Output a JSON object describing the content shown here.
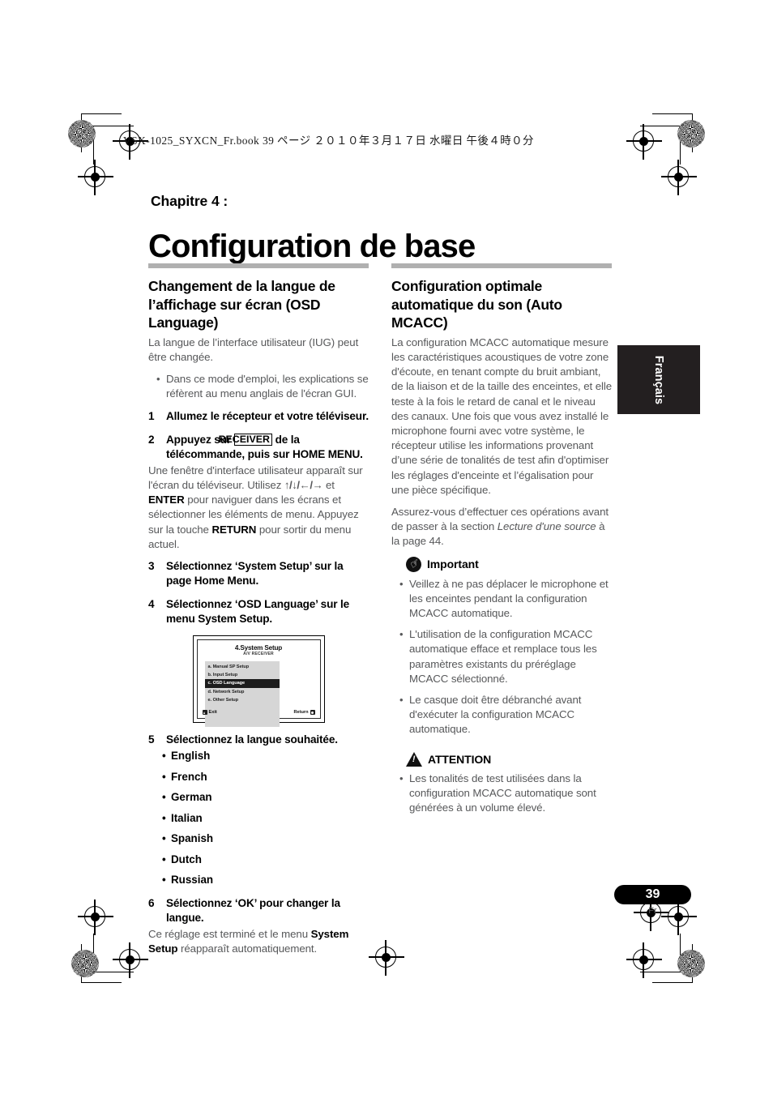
{
  "running_header": "VSX-1025_SYXCN_Fr.book   39 ページ   ２０１０年３月１７日   水曜日   午後４時０分",
  "chapter": {
    "label": "Chapitre 4 :",
    "title": "Configuration de base"
  },
  "side_tab": {
    "label": "Français"
  },
  "page_footer": {
    "number": "39",
    "language_code": "Fr"
  },
  "left_column": {
    "heading": "Changement de la langue de l’affichage sur écran (OSD Language)",
    "intro": "La langue de l’interface utilisateur (IUG) peut être changée.",
    "intro_bullets": [
      "Dans ce mode d'emploi, les explications se réfèrent au menu anglais de l'écran GUI."
    ],
    "step1": {
      "num": "1",
      "text": "Allumez le récepteur et votre téléviseur."
    },
    "step2": {
      "num": "2",
      "text_before": "Appuyez sur",
      "kbd": "RECEIVER",
      "text_after": "de la télécommande, puis sur HOME MENU.",
      "body_1": "Une fenêtre d'interface utilisateur apparaît sur l'écran du téléviseur. Utilisez",
      "arrows": "↑/↓/←/→",
      "body_2": "et",
      "enter_label": "ENTER",
      "body_3": "pour naviguer dans les écrans et sélectionner les éléments de menu. Appuyez sur la touche",
      "return_label": "RETURN",
      "body_4": "pour sortir du menu actuel."
    },
    "step3": {
      "num": "3",
      "text": "Sélectionnez ‘System Setup’ sur la page Home Menu."
    },
    "step4": {
      "num": "4",
      "text": "Sélectionnez ‘OSD Language’ sur le menu System Setup."
    },
    "osd_screen": {
      "title": "4.System Setup",
      "subtitle": "A/V RECEIVER",
      "items": [
        {
          "label": "a. Manual SP Setup",
          "selected": false
        },
        {
          "label": "b. Input Setup",
          "selected": false
        },
        {
          "label": "c. OSD Language",
          "selected": true
        },
        {
          "label": "d. Network Setup",
          "selected": false
        },
        {
          "label": "e. Other Setup",
          "selected": false
        }
      ],
      "footer_left": "Exit",
      "footer_right": "Return"
    },
    "step5": {
      "num": "5",
      "text": "Sélectionnez la langue souhaitée."
    },
    "languages": [
      "English",
      "French",
      "German",
      "Italian",
      "Spanish",
      "Dutch",
      "Russian"
    ],
    "step6": {
      "num": "6",
      "text": "Sélectionnez ‘OK’ pour changer la langue."
    },
    "step6_body_1": "Ce réglage est terminé et le menu",
    "step6_bold": "System Setup",
    "step6_body_2": "réapparaît automatiquement."
  },
  "right_column": {
    "heading": "Configuration optimale automatique du son (Auto MCACC)",
    "para_1": "La configuration MCACC automatique mesure les caractéristiques acoustiques de votre zone d'écoute, en tenant compte du bruit ambiant, de la liaison et de la taille des enceintes, et elle teste à la fois le retard de canal et le niveau des canaux. Une fois que vous avez installé le microphone fourni avec votre système, le récepteur utilise les informations provenant d’une série de tonalités de test afin d'optimiser les réglages d'enceinte et l’égalisation pour une pièce spécifique.",
    "para_2_before": "Assurez-vous d’effectuer ces opérations avant de passer à la section",
    "para_2_italic": "Lecture d'une source",
    "para_2_after": "à la page 44.",
    "important": {
      "title": "Important",
      "icon": "pointing-hand-icon",
      "bullets": [
        "Veillez à ne pas déplacer le microphone et les enceintes pendant la configuration MCACC automatique.",
        "L'utilisation de la configuration MCACC automatique efface et remplace tous les paramètres existants du préréglage MCACC sélectionné.",
        "Le casque doit être débranché avant d'exécuter la configuration MCACC automatique."
      ]
    },
    "attention": {
      "title": "ATTENTION",
      "icon": "warning-triangle-icon",
      "bullets": [
        "Les tonalités de test utilisées dans la configuration MCACC automatique sont générées à un volume élevé."
      ]
    }
  }
}
